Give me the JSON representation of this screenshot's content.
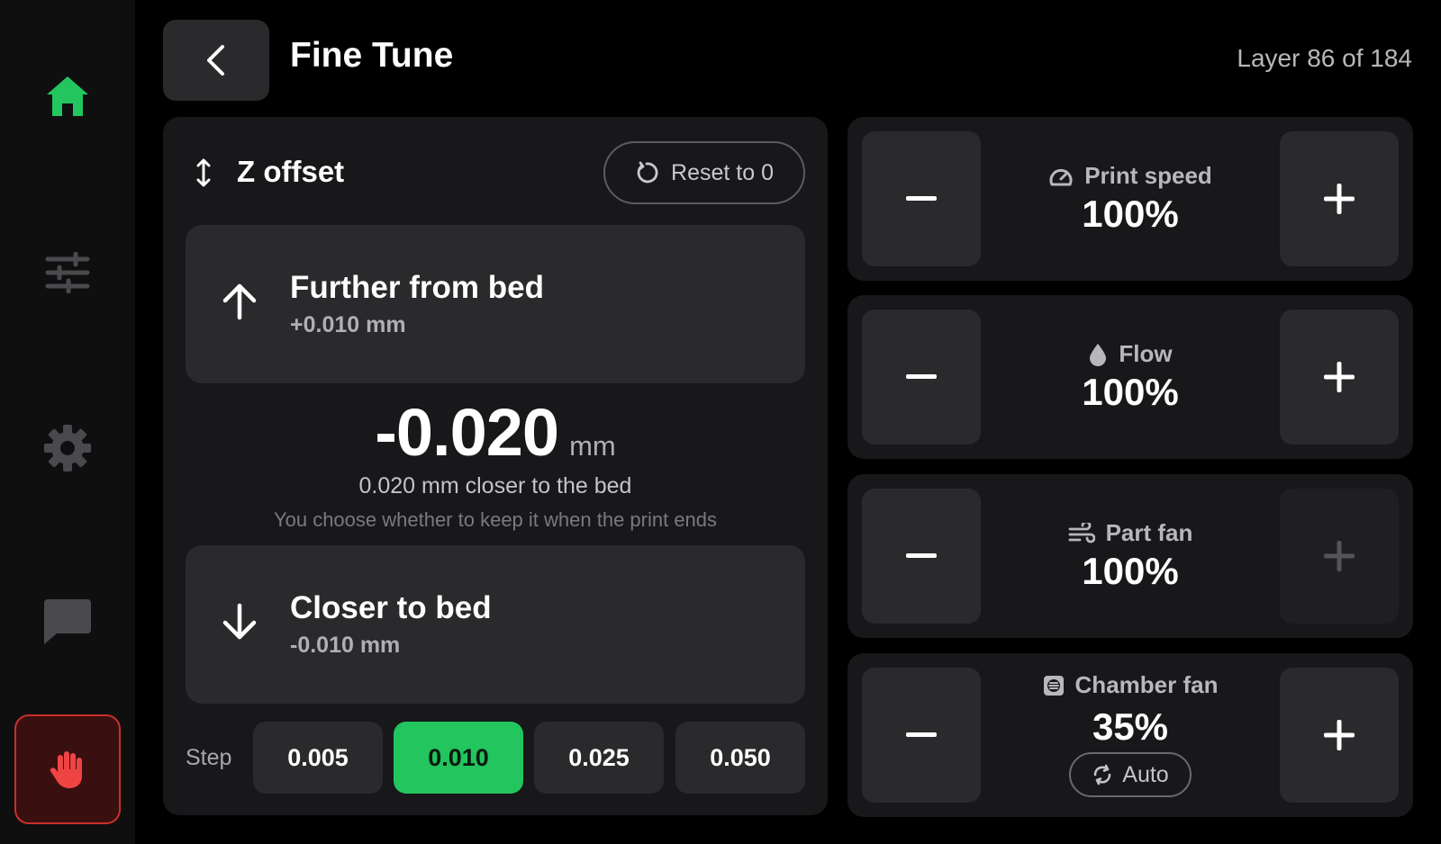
{
  "header": {
    "title": "Fine Tune",
    "layer_info": "Layer 86 of 184"
  },
  "sidebar": {
    "items": [
      {
        "icon": "home-icon",
        "active": true
      },
      {
        "icon": "sliders-icon",
        "active": false
      },
      {
        "icon": "gear-icon",
        "active": false
      },
      {
        "icon": "chat-icon",
        "active": false
      }
    ],
    "estop_icon": "hand-stop-icon"
  },
  "z_offset": {
    "title": "Z offset",
    "reset_label": "Reset to 0",
    "further": {
      "title": "Further from bed",
      "delta": "+0.010 mm"
    },
    "value": "-0.020",
    "unit": "mm",
    "description": "0.020 mm closer to the bed",
    "note": "You choose whether to keep it when the print ends",
    "closer": {
      "title": "Closer to bed",
      "delta": "-0.010 mm"
    },
    "step_label": "Step",
    "steps": [
      "0.005",
      "0.010",
      "0.025",
      "0.050"
    ],
    "active_step": "0.010"
  },
  "tuning": {
    "print_speed": {
      "label": "Print speed",
      "value": "100%",
      "icon": "speedometer-icon"
    },
    "flow": {
      "label": "Flow",
      "value": "100%",
      "icon": "droplet-icon"
    },
    "part_fan": {
      "label": "Part fan",
      "value": "100%",
      "icon": "wind-icon",
      "plus_disabled": true
    },
    "chamber_fan": {
      "label": "Chamber fan",
      "value": "35%",
      "icon": "chamber-fan-icon",
      "auto_label": "Auto"
    }
  },
  "colors": {
    "accent": "#22c55e",
    "estop": "#c9302c",
    "panel": "#18181a",
    "button": "#2a2a2c"
  }
}
